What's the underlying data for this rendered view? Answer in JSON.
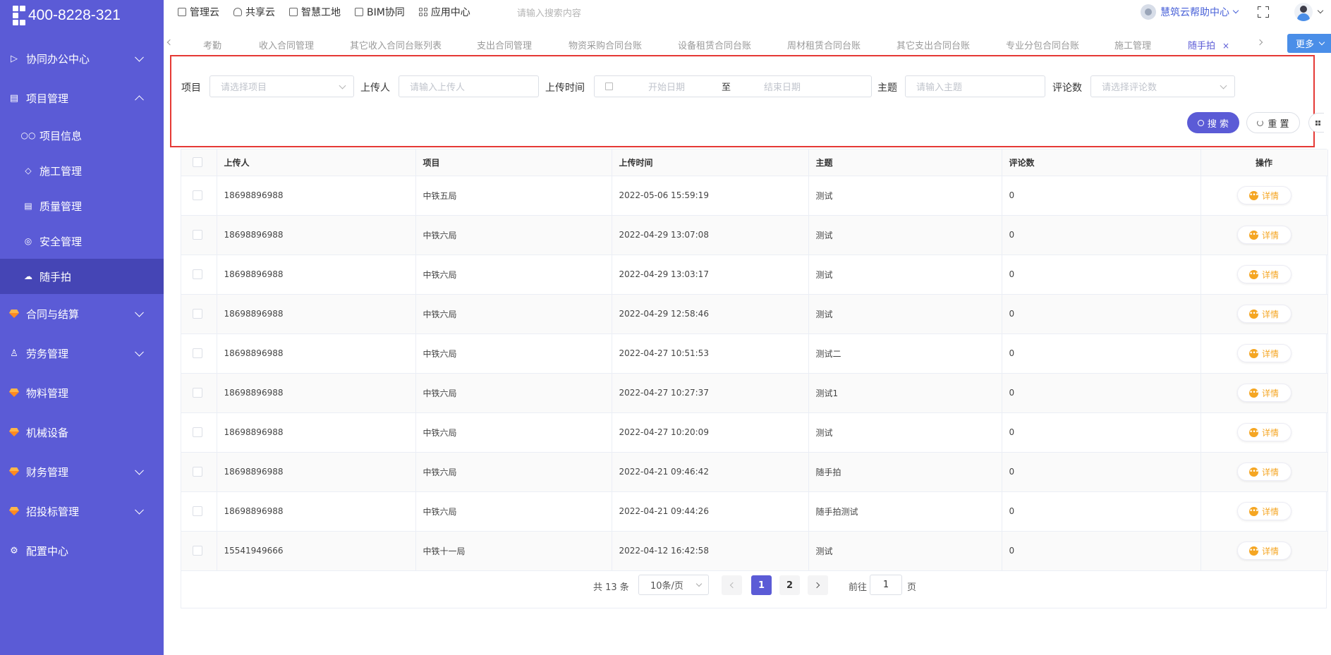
{
  "sidebar": {
    "hotline": "400-8228-321",
    "items": [
      {
        "label": "协同办公中心"
      },
      {
        "label": "项目管理"
      },
      {
        "label": "合同与结算"
      },
      {
        "label": "劳务管理"
      },
      {
        "label": "物料管理"
      },
      {
        "label": "机械设备"
      },
      {
        "label": "财务管理"
      },
      {
        "label": "招投标管理"
      },
      {
        "label": "配置中心"
      }
    ],
    "sub_items": [
      {
        "label": "项目信息"
      },
      {
        "label": "施工管理"
      },
      {
        "label": "质量管理"
      },
      {
        "label": "安全管理"
      },
      {
        "label": "随手拍"
      }
    ]
  },
  "topbar": {
    "nav": [
      "管理云",
      "共享云",
      "智慧工地",
      "BIM协同",
      "应用中心"
    ],
    "search_placeholder": "请输入搜索内容",
    "help_label": "慧筑云帮助中心"
  },
  "tabs": {
    "items": [
      "考勤",
      "收入合同管理",
      "其它收入合同台账列表",
      "支出合同管理",
      "物资采购合同台账",
      "设备租赁合同台账",
      "周材租赁合同台账",
      "其它支出合同台账",
      "专业分包合同台账",
      "施工管理",
      "随手拍"
    ],
    "close_glyph": "×",
    "more_label": "更多"
  },
  "filter": {
    "project_label": "项目",
    "project_placeholder": "请选择项目",
    "uploader_label": "上传人",
    "uploader_placeholder": "请输入上传人",
    "time_label": "上传时间",
    "start_placeholder": "开始日期",
    "range_sep": "至",
    "end_placeholder": "结束日期",
    "subject_label": "主题",
    "subject_placeholder": "请输入主题",
    "comments_label": "评论数",
    "comments_placeholder": "请选择评论数",
    "search_label": "搜 索",
    "reset_label": "重 置"
  },
  "table": {
    "headers": {
      "uploader": "上传人",
      "project": "项目",
      "time": "上传时间",
      "subject": "主题",
      "comments": "评论数",
      "ops": "操作"
    },
    "detail_label": "详情",
    "rows": [
      {
        "uploader": "18698896988",
        "project": "中铁五局",
        "time": "2022-05-06 15:59:19",
        "subject": "测试",
        "comments": "0"
      },
      {
        "uploader": "18698896988",
        "project": "中铁六局",
        "time": "2022-04-29 13:07:08",
        "subject": "测试",
        "comments": "0"
      },
      {
        "uploader": "18698896988",
        "project": "中铁六局",
        "time": "2022-04-29 13:03:17",
        "subject": "测试",
        "comments": "0"
      },
      {
        "uploader": "18698896988",
        "project": "中铁六局",
        "time": "2022-04-29 12:58:46",
        "subject": "测试",
        "comments": "0"
      },
      {
        "uploader": "18698896988",
        "project": "中铁六局",
        "time": "2022-04-27 10:51:53",
        "subject": "测试二",
        "comments": "0"
      },
      {
        "uploader": "18698896988",
        "project": "中铁六局",
        "time": "2022-04-27 10:27:37",
        "subject": "测试1",
        "comments": "0"
      },
      {
        "uploader": "18698896988",
        "project": "中铁六局",
        "time": "2022-04-27 10:20:09",
        "subject": "测试",
        "comments": "0"
      },
      {
        "uploader": "18698896988",
        "project": "中铁六局",
        "time": "2022-04-21 09:46:42",
        "subject": "随手拍",
        "comments": "0"
      },
      {
        "uploader": "18698896988",
        "project": "中铁六局",
        "time": "2022-04-21 09:44:26",
        "subject": "随手拍测试",
        "comments": "0"
      },
      {
        "uploader": "15541949666",
        "project": "中铁十一局",
        "time": "2022-04-12 16:42:58",
        "subject": "测试",
        "comments": "0"
      }
    ]
  },
  "pagination": {
    "total": "共 13 条",
    "page_size": "10条/页",
    "pages": [
      "1",
      "2"
    ],
    "goto_label": "前往",
    "goto_value": "1",
    "unit": "页"
  },
  "colors": {
    "sidebar": "#5b5bd6",
    "sidebar_active": "#4545b5",
    "accent": "#5b5bd6",
    "detail": "#f5a623",
    "highlight_border": "#e53935",
    "more_button": "#4a8ee8"
  }
}
